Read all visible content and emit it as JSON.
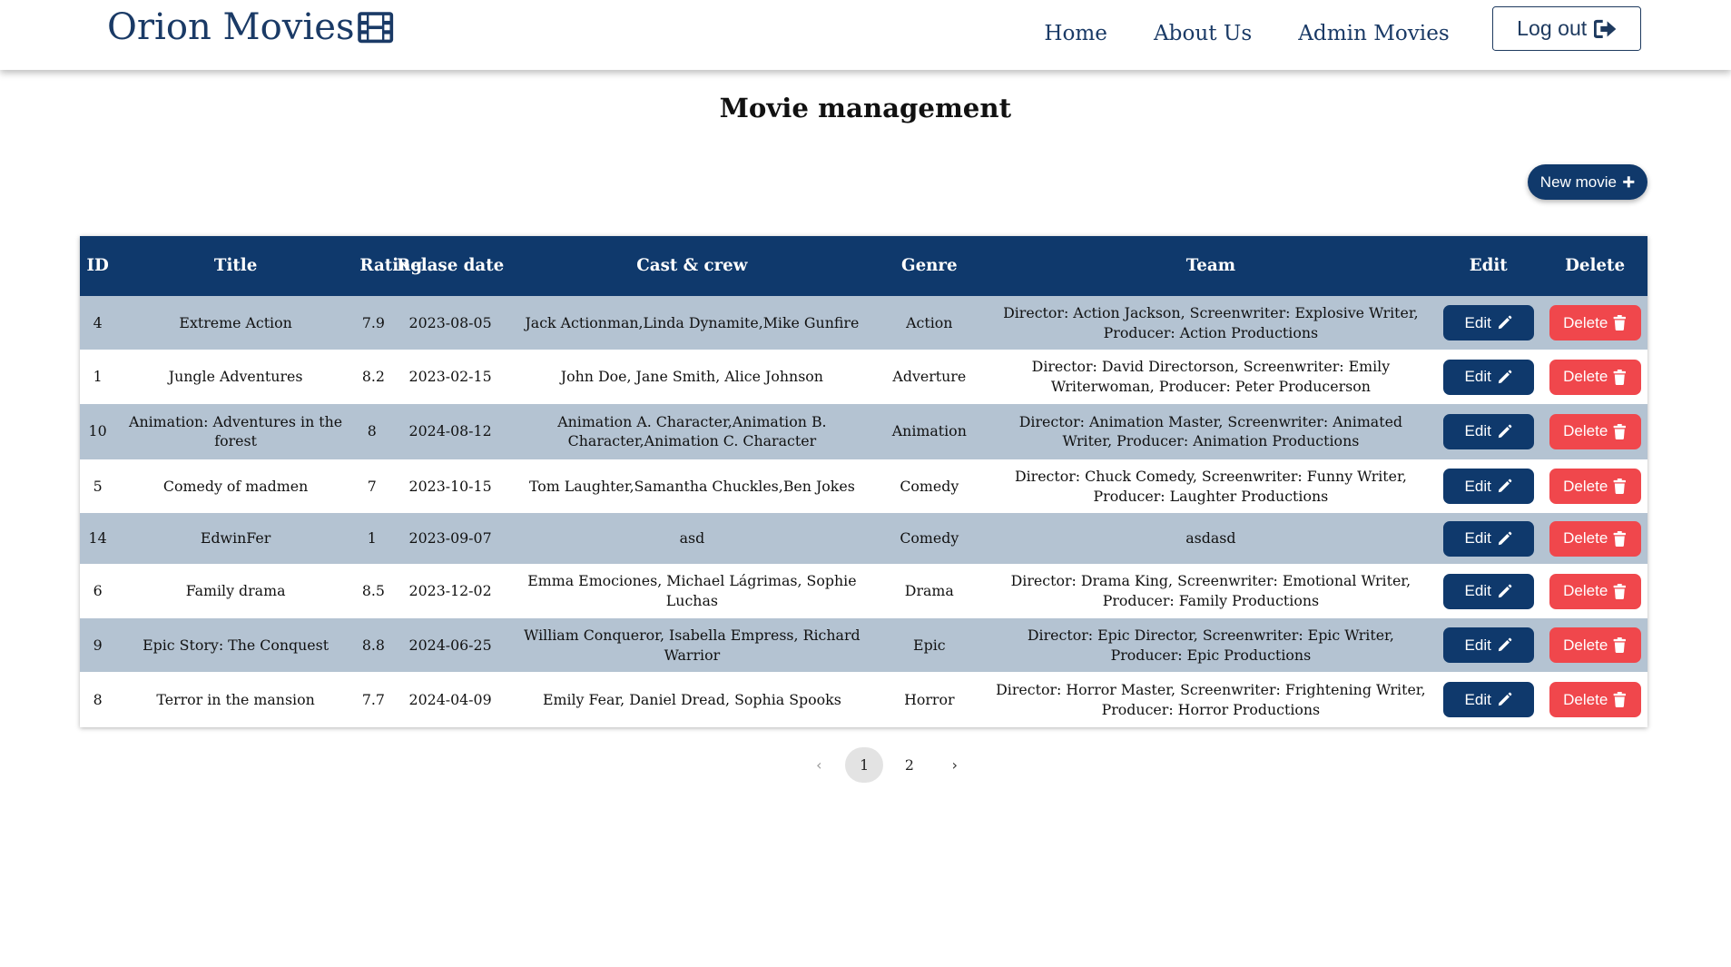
{
  "brand": {
    "name": "Orion Movies",
    "icon": "film-icon"
  },
  "nav": {
    "links": [
      "Home",
      "About Us",
      "Admin Movies"
    ],
    "logout_label": "Log out",
    "logout_icon": "logout-icon"
  },
  "page": {
    "title": "Movie management",
    "new_movie_label": "New movie"
  },
  "table": {
    "headers": [
      "ID",
      "Title",
      "Rating",
      "Relase date",
      "Cast & crew",
      "Genre",
      "Team",
      "Edit",
      "Delete"
    ],
    "edit_label": "Edit",
    "delete_label": "Delete",
    "rows": [
      {
        "id": "4",
        "title": "Extreme Action",
        "rating": "7.9",
        "date": "2023-08-05",
        "cast": "Jack Actionman,Linda Dynamite,Mike Gunfire",
        "genre": "Action",
        "team": "Director: Action Jackson, Screenwriter: Explosive Writer, Producer: Action Productions"
      },
      {
        "id": "1",
        "title": "Jungle Adventures",
        "rating": "8.2",
        "date": "2023-02-15",
        "cast": "John Doe, Jane Smith, Alice Johnson",
        "genre": "Adverture",
        "team": "Director: David Directorson, Screenwriter: Emily Writerwoman, Producer: Peter Producerson"
      },
      {
        "id": "10",
        "title": "Animation: Adventures in the forest",
        "rating": "8",
        "date": "2024-08-12",
        "cast": "Animation A. Character,Animation B. Character,Animation C. Character",
        "genre": "Animation",
        "team": "Director: Animation Master, Screenwriter: Animated Writer, Producer: Animation Productions"
      },
      {
        "id": "5",
        "title": "Comedy of madmen",
        "rating": "7",
        "date": "2023-10-15",
        "cast": "Tom Laughter,Samantha Chuckles,Ben Jokes",
        "genre": "Comedy",
        "team": "Director: Chuck Comedy, Screenwriter: Funny Writer, Producer: Laughter Productions"
      },
      {
        "id": "14",
        "title": "EdwinFer",
        "rating": "1",
        "date": "2023-09-07",
        "cast": "asd",
        "genre": "Comedy",
        "team": "asdasd"
      },
      {
        "id": "6",
        "title": "Family drama",
        "rating": "8.5",
        "date": "2023-12-02",
        "cast": "Emma Emociones, Michael Lágrimas, Sophie Luchas",
        "genre": "Drama",
        "team": "Director: Drama King, Screenwriter: Emotional Writer, Producer: Family Productions"
      },
      {
        "id": "9",
        "title": "Epic Story: The Conquest",
        "rating": "8.8",
        "date": "2024-06-25",
        "cast": "William Conqueror, Isabella Empress, Richard Warrior",
        "genre": "Epic",
        "team": "Director: Epic Director, Screenwriter: Epic Writer, Producer: Epic Productions"
      },
      {
        "id": "8",
        "title": "Terror in the mansion",
        "rating": "7.7",
        "date": "2024-04-09",
        "cast": "Emily Fear, Daniel Dread, Sophia Spooks",
        "genre": "Horror",
        "team": "Director: Horror Master, Screenwriter: Frightening Writer, Producer: Horror Productions"
      }
    ]
  },
  "pagination": {
    "pages": [
      "1",
      "2"
    ],
    "current": "1",
    "prev": "‹",
    "next": "›"
  },
  "colors": {
    "primary": "#0f396c",
    "danger": "#f0474c",
    "row_alt": "#b4c3d2",
    "brand_text": "#1a3a66"
  }
}
